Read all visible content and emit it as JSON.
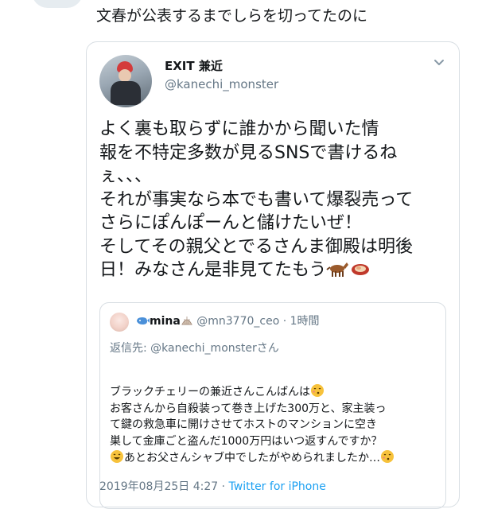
{
  "status_text": "文春が公表するまでしらを切ってたのに",
  "tweet": {
    "author_name": "EXIT 兼近",
    "author_handle": "@kanechi_monster",
    "body_lines": [
      "よく裏も取らずに誰かから聞いた情",
      "報を不特定多数が見るSNSで書けるね",
      "ぇ、、、",
      "それが事実なら本でも書いて爆裂売って",
      "さらにぽんぽーんと儲けたいぜ！",
      "そしてその親父とでるさんま御殿は明後",
      "日！みなさん是非見てたもう"
    ],
    "body_emoji_icons": [
      "horse-icon",
      "meat-icon"
    ],
    "timestamp": "2019年08月25日 4:27",
    "separator": " · ",
    "source": "Twitter for iPhone"
  },
  "quote": {
    "name": "mina",
    "name_icons": [
      "whale-icon",
      "shell-icon"
    ],
    "handle": "@mn3770_ceo",
    "separator": " · ",
    "time": "1時間",
    "reply_to": "返信先: @kanechi_monsterさん",
    "body_lines": [
      "ブラックチェリーの兼近さんこんばんは",
      "お客さんから自殺装って巻き上げた300万と、家主装っ",
      "て鍵の救急車に開けさせてホストのマンションに空き",
      "巣して金庫ごと盗んだ1000万円はいつ返すんですか？",
      "あとお父さんシャブ中でしたがやめられましたか…"
    ],
    "body_emoji_icons": [
      "kissing-face-icon",
      "grinning-face-icon",
      "kissing-face-icon"
    ]
  },
  "colors": {
    "text": "#14171a",
    "secondary": "#657786",
    "link": "#1da1f2",
    "border": "#d8dee3"
  }
}
